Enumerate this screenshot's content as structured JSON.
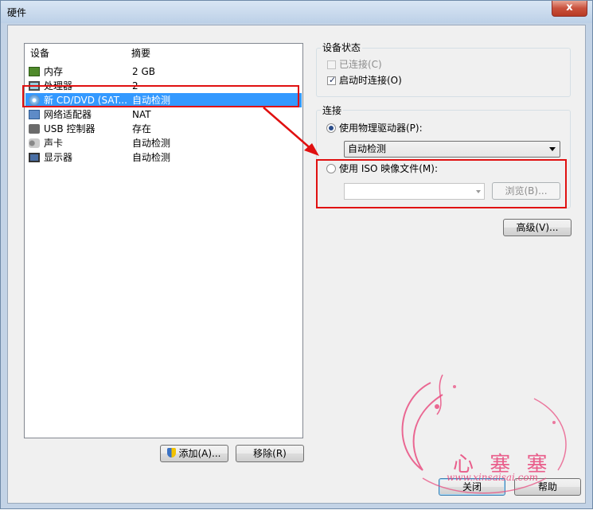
{
  "window": {
    "title": "硬件",
    "close_glyph": "x"
  },
  "device_list": {
    "headers": {
      "device": "设备",
      "summary": "摘要"
    },
    "rows": [
      {
        "name": "内存",
        "summary": "2 GB",
        "icon": "memory-icon"
      },
      {
        "name": "处理器",
        "summary": "2",
        "icon": "processor-icon"
      },
      {
        "name": "新 CD/DVD (SAT...",
        "summary": "自动检测",
        "icon": "cd-dvd-icon",
        "selected": true
      },
      {
        "name": "网络适配器",
        "summary": "NAT",
        "icon": "network-adapter-icon"
      },
      {
        "name": "USB 控制器",
        "summary": "存在",
        "icon": "usb-icon"
      },
      {
        "name": "声卡",
        "summary": "自动检测",
        "icon": "sound-card-icon"
      },
      {
        "name": "显示器",
        "summary": "自动检测",
        "icon": "display-icon"
      }
    ]
  },
  "list_buttons": {
    "add": "添加(A)...",
    "remove": "移除(R)"
  },
  "device_status": {
    "label": "设备状态",
    "connected": {
      "label": "已连接(C)",
      "checked": false,
      "enabled": false
    },
    "connect_at_power_on": {
      "label": "启动时连接(O)",
      "checked": true
    }
  },
  "connection": {
    "label": "连接",
    "use_physical": {
      "label": "使用物理驱动器(P):",
      "selected": true
    },
    "physical_drive_value": "自动检测",
    "use_iso": {
      "label": "使用 ISO 映像文件(M):",
      "selected": false
    },
    "iso_path_value": "",
    "browse_label": "浏览(B)..."
  },
  "advanced_label": "高级(V)...",
  "footer": {
    "close": "关闭",
    "help": "帮助"
  },
  "watermark": {
    "text": "心 塞 塞",
    "url": "www.xinsaisai.com"
  },
  "colors": {
    "selection": "#3399ff",
    "annotation_red": "#e01010",
    "watermark_pink": "#e8457a"
  }
}
